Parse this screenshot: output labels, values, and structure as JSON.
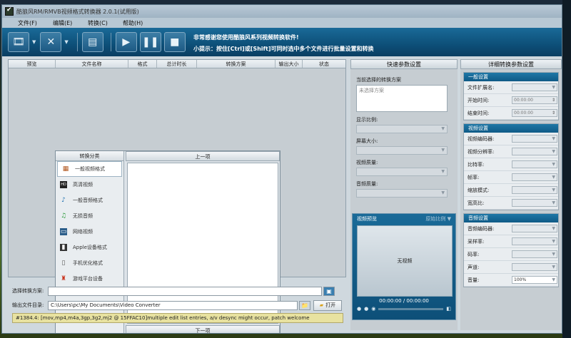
{
  "window": {
    "title": "酷狼风RM/RMVB视频格式转换器 2.0.1(试用版)"
  },
  "menu": [
    "文件(F)",
    "编辑(E)",
    "转换(C)",
    "帮助(H)"
  ],
  "toolbar": {
    "message": "非常感谢您使用酷狼风系列视频转换软件!",
    "hint": "小提示：按住[Ctrl]或[Shift]可同时选中多个文件进行批量设置和转换"
  },
  "file_list": {
    "columns": [
      "预览",
      "文件名称",
      "格式",
      "总计时长",
      "转换方案",
      "输出大小",
      "状态"
    ]
  },
  "conversion_popup": {
    "category_header": "转换分类",
    "prev": "上一项",
    "next": "下一项",
    "categories": [
      {
        "label": "一般视频格式",
        "icon": "film-icon"
      },
      {
        "label": "高清视频",
        "icon": "hd-icon"
      },
      {
        "label": "一般音频格式",
        "icon": "music-note-icon"
      },
      {
        "label": "无损音频",
        "icon": "music-notes-icon"
      },
      {
        "label": "网络视频",
        "icon": "web-video-icon"
      },
      {
        "label": "Apple设备格式",
        "icon": "apple-device-icon"
      },
      {
        "label": "手机优化格式",
        "icon": "phone-icon"
      },
      {
        "label": "游戏平台设备",
        "icon": "game-character-icon"
      }
    ]
  },
  "bottom": {
    "scheme_label": "选择转换方案:",
    "output_label": "输出文件目录:",
    "output_path": "C:\\Users\\pc\\My Documents\\Video Converter",
    "open_button": "打开",
    "status": "#1384.4: [mov,mp4,m4a,3gp,3g2,mj2 @ 15FFAC10]multiple edit list entries, a/v desync might occur, patch welcome"
  },
  "quick_settings": {
    "title": "快速参数设置",
    "current_scheme_label": "当前选择的转换方案",
    "current_scheme_placeholder": "未选择方案",
    "display_ratio": "显示比例:",
    "screen_size": "屏幕大小:",
    "video_quality": "视频质量:",
    "audio_quality": "音频质量:"
  },
  "preview": {
    "title": "视频预览",
    "ratio": "原始比例",
    "no_video": "无视频",
    "time_current": "00:00:00",
    "time_sep": "/",
    "time_total": "00:00:00"
  },
  "detail_settings": {
    "title": "详细转换参数设置",
    "general": {
      "header": "一般设置",
      "ext_label": "文件扩展名:",
      "start_label": "开始时间:",
      "start_value": "00:00:00",
      "end_label": "结束时间:",
      "end_value": "00:00:00"
    },
    "video": {
      "header": "视频设置",
      "rows": [
        "视频编码器:",
        "视频分辨率:",
        "比特率:",
        "帧率:",
        "缩放模式:",
        "宽高比:"
      ]
    },
    "audio": {
      "header": "音频设置",
      "rows": [
        "音频编码器:",
        "采样率:",
        "码率:",
        "声道:"
      ],
      "volume_label": "音量:",
      "volume_value": "100%"
    }
  }
}
